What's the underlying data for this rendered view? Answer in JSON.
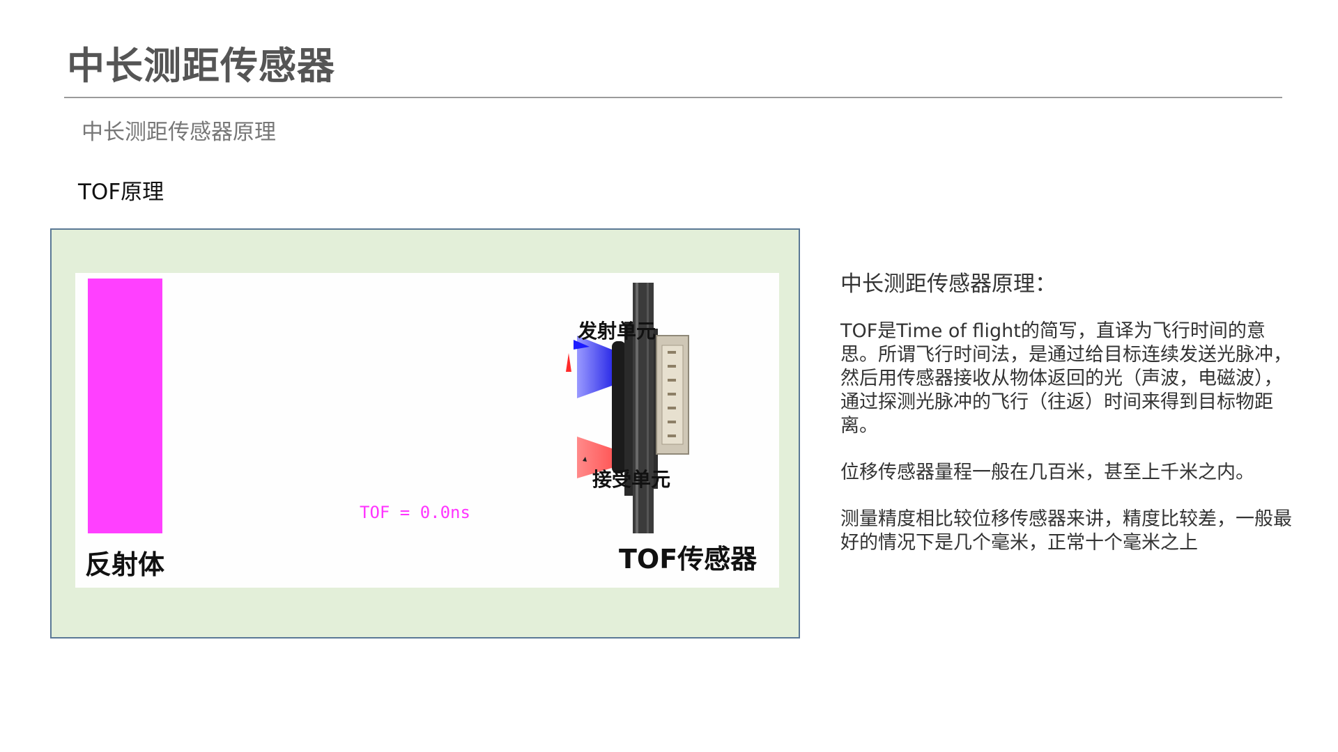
{
  "slide": {
    "title": "中长测距传感器",
    "subtitle": "中长测距传感器原理",
    "section_label": "TOF原理"
  },
  "figure": {
    "reflector_label": "反射体",
    "emitter_label": "发射单元",
    "receiver_label": "接受单元",
    "sensor_label": "TOF传感器",
    "tof_readout": "TOF = 0.0ns",
    "colors": {
      "frame_border": "#5a7895",
      "frame_fill": "#e3efd9",
      "reflector": "#ff40ff",
      "emit_beam": "#3b3bff",
      "receive_beam": "#ff4a4a",
      "readout": "#ff33ff"
    }
  },
  "description": {
    "heading": "中长测距传感器原理：",
    "paragraphs": [
      "TOF是Time of flight的简写，直译为飞行时间的意思。所谓飞行时间法，是通过给目标连续发送光脉冲，然后用传感器接收从物体返回的光（声波，电磁波），通过探测光脉冲的飞行（往返）时间来得到目标物距离。",
      "位移传感器量程一般在几百米，甚至上千米之内。",
      "测量精度相比较位移传感器来讲，精度比较差，一般最好的情况下是几个毫米，正常十个毫米之上"
    ]
  }
}
